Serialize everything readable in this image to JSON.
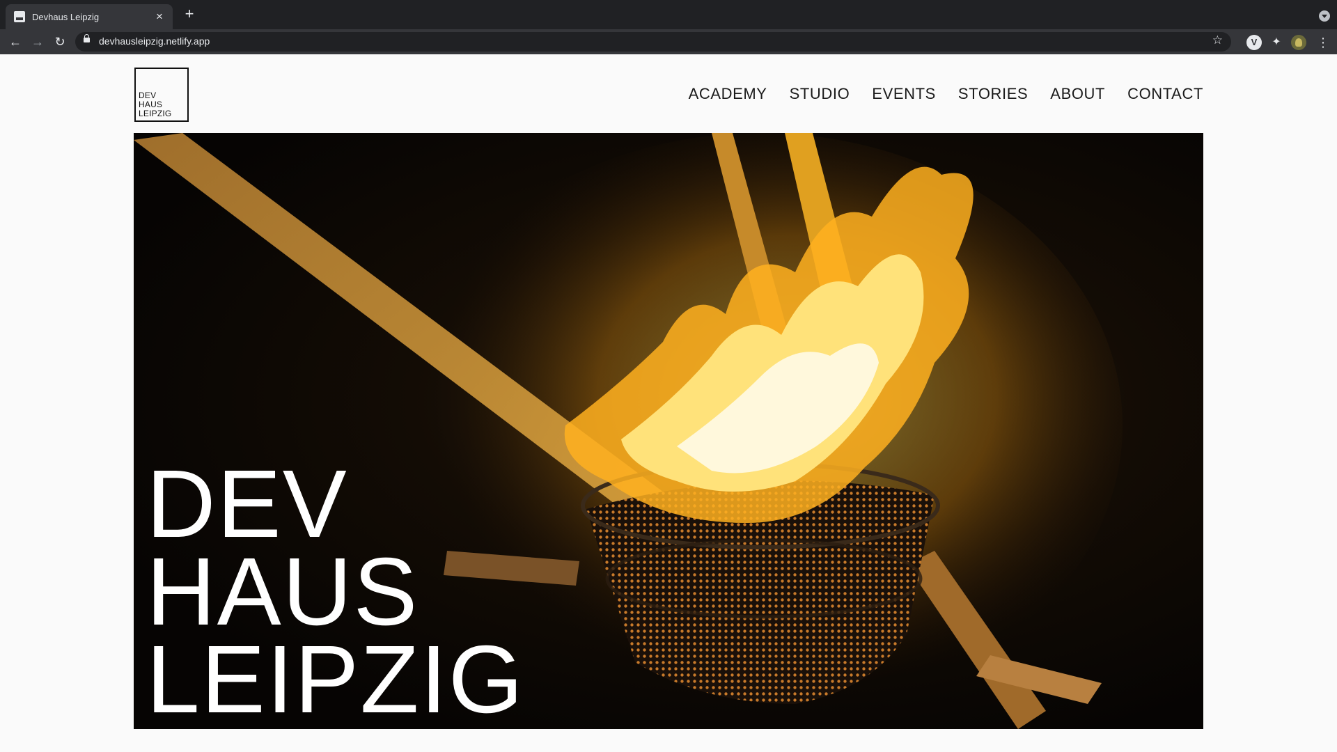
{
  "browser": {
    "tab_title": "Devhaus Leipzig",
    "tab_close": "×",
    "new_tab": "+",
    "url": "devhausleipzig.netlify.app",
    "back": "←",
    "forward": "→",
    "reload": "↻",
    "bookmark": "☆",
    "extension_letter": "V",
    "extension_puzzle": "✦",
    "menu": "⋮"
  },
  "site": {
    "logo_lines": [
      "DEV",
      "HAUS",
      "LEIPZIG"
    ],
    "nav": [
      "ACADEMY",
      "STUDIO",
      "EVENTS",
      "STORIES",
      "ABOUT",
      "CONTACT"
    ],
    "hero_title_lines": [
      "DEV",
      "HAUS",
      "LEIPZIG"
    ]
  }
}
